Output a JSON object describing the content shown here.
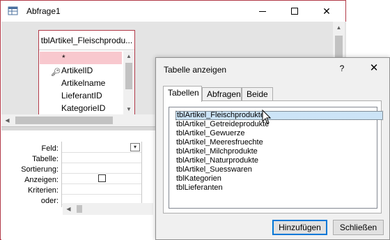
{
  "window": {
    "title": "Abfrage1",
    "minimize": "",
    "maximize": "",
    "close": "✕"
  },
  "design_table": {
    "title": "tblArtikel_Fleischprodu...",
    "fields": [
      "*",
      "ArtikelID",
      "Artikelname",
      "LieferantID",
      "KategorieID"
    ]
  },
  "grid": {
    "row_labels": [
      "Feld:",
      "Tabelle:",
      "Sortierung:",
      "Anzeigen:",
      "Kriterien:",
      "oder:"
    ]
  },
  "dialog": {
    "title": "Tabelle anzeigen",
    "help": "?",
    "close": "✕",
    "tabs": [
      "Tabellen",
      "Abfragen",
      "Beide"
    ],
    "items": [
      "tblArtikel_Fleischprodukte",
      "tblArtikel_Getreideprodukte",
      "tblArtikel_Gewuerze",
      "tblArtikel_Meeresfruechte",
      "tblArtikel_Milchprodukte",
      "tblArtikel_Naturprodukte",
      "tblArtikel_Suesswaren",
      "tblKategorien",
      "tblLieferanten"
    ],
    "add_button": "Hinzufügen",
    "close_button": "Schließen"
  },
  "colors": {
    "accent_border": "#b23a48",
    "selection": "#cce4f7",
    "default_button_border": "#0078d7"
  },
  "icons": [
    "app-query-icon",
    "key-icon",
    "mouse-cursor-icon"
  ]
}
